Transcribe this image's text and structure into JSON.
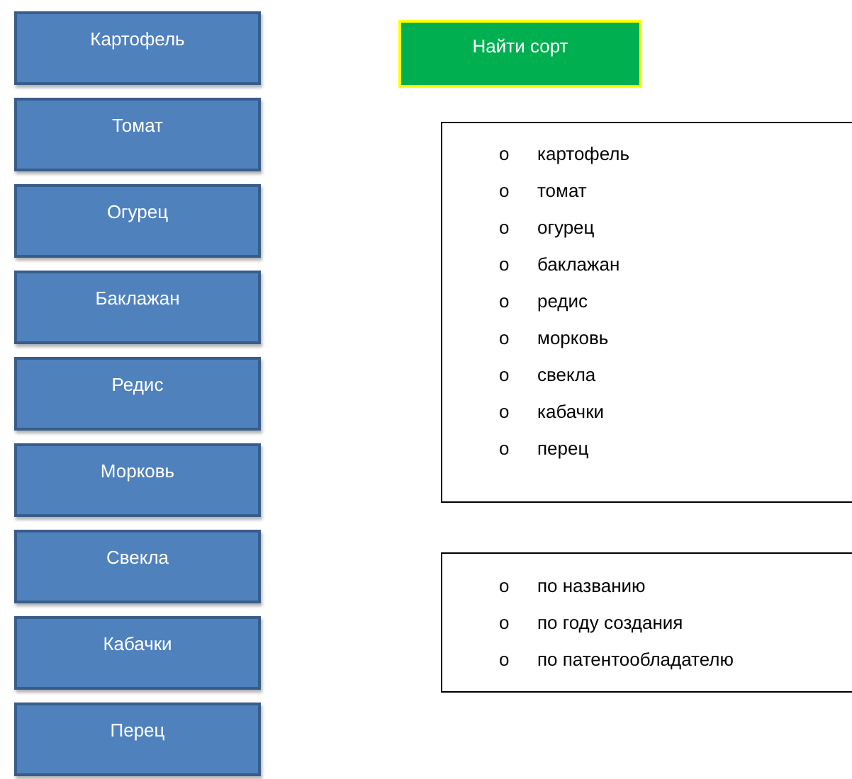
{
  "variety_buttons": [
    {
      "label": "Картофель"
    },
    {
      "label": "Томат"
    },
    {
      "label": "Огурец"
    },
    {
      "label": "Баклажан"
    },
    {
      "label": "Редис"
    },
    {
      "label": "Морковь"
    },
    {
      "label": "Свекла"
    },
    {
      "label": "Кабачки"
    },
    {
      "label": "Перец"
    }
  ],
  "find_button": {
    "label": "Найти сорт"
  },
  "crop_list": [
    {
      "marker": "o",
      "label": "картофель"
    },
    {
      "marker": "o",
      "label": "томат"
    },
    {
      "marker": "o",
      "label": "огурец"
    },
    {
      "marker": "o",
      "label": "баклажан"
    },
    {
      "marker": "o",
      "label": "редис"
    },
    {
      "marker": "o",
      "label": "морковь"
    },
    {
      "marker": "o",
      "label": "свекла"
    },
    {
      "marker": "o",
      "label": "кабачки"
    },
    {
      "marker": "o",
      "label": "перец"
    }
  ],
  "search_options": [
    {
      "marker": "o",
      "label": "по названию"
    },
    {
      "marker": "o",
      "label": "по году создания"
    },
    {
      "marker": "o",
      "label": "по патентообладателю"
    }
  ]
}
